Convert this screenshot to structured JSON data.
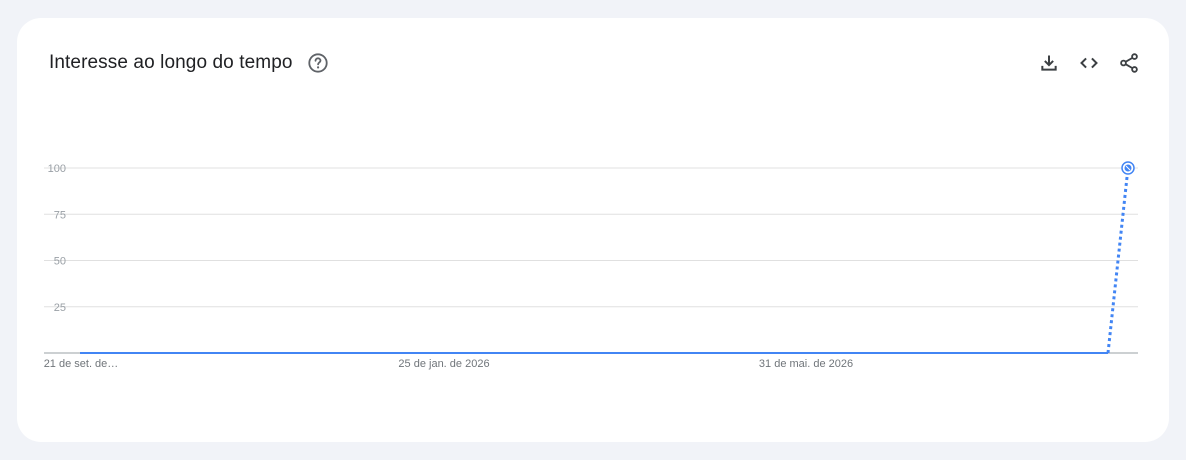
{
  "card": {
    "title": "Interesse ao longo do tempo",
    "icons": {
      "help": "help-circle-icon",
      "download": "download-icon",
      "embed": "code-icon",
      "share": "share-icon"
    }
  },
  "colors": {
    "series": "#4285f4",
    "grid": "#e0e0e0",
    "axis": "#9aa0a6"
  },
  "chart_data": {
    "type": "line",
    "title": "Interesse ao longo do tempo",
    "xlabel": "",
    "ylabel": "",
    "ylim": [
      0,
      100
    ],
    "yticks": [
      25,
      50,
      75,
      100
    ],
    "xtick_labels": [
      "21 de set. de…",
      "25 de jan. de 2026",
      "31 de mai. de 2026"
    ],
    "grid": true,
    "series": [
      {
        "solid_values": [
          0,
          0
        ],
        "partial_segment": [
          0,
          100
        ],
        "note_style": "last segment dotted (partial data)"
      }
    ]
  }
}
